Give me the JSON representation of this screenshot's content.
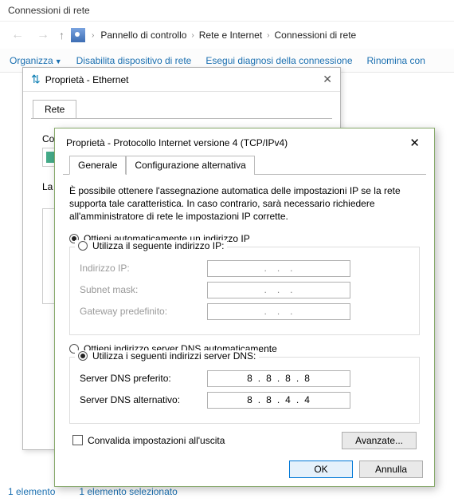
{
  "window": {
    "title": "Connessioni di rete"
  },
  "breadcrumb": {
    "items": [
      "Pannello di controllo",
      "Rete e Internet",
      "Connessioni di rete"
    ]
  },
  "toolbar": {
    "organize": "Organizza",
    "disable": "Disabilita dispositivo di rete",
    "diagnose": "Esegui diagnosi della connessione",
    "rename": "Rinomina con"
  },
  "eth_dialog": {
    "title": "Proprietà - Ethernet",
    "tab_net": "Rete",
    "connect_label": "Co",
    "list_label": "La"
  },
  "ipv4_dialog": {
    "title": "Proprietà - Protocollo Internet versione 4 (TCP/IPv4)",
    "tab_general": "Generale",
    "tab_alt": "Configurazione alternativa",
    "description": "È possibile ottenere l'assegnazione automatica delle impostazioni IP se la rete supporta tale caratteristica. In caso contrario, sarà necessario richiedere all'amministratore di rete le impostazioni IP corrette.",
    "radio_ip_auto": "Ottieni automaticamente un indirizzo IP",
    "radio_ip_manual": "Utilizza il seguente indirizzo IP:",
    "label_ip": "Indirizzo IP:",
    "label_mask": "Subnet mask:",
    "label_gateway": "Gateway predefinito:",
    "radio_dns_auto": "Ottieni indirizzo server DNS automaticamente",
    "radio_dns_manual": "Utilizza i seguenti indirizzi server DNS:",
    "label_dns1": "Server DNS preferito:",
    "label_dns2": "Server DNS alternativo:",
    "dns1": [
      "8",
      "8",
      "8",
      "8"
    ],
    "dns2": [
      "8",
      "8",
      "4",
      "4"
    ],
    "validate": "Convalida impostazioni all'uscita",
    "advanced": "Avanzate...",
    "ok": "OK",
    "cancel": "Annulla"
  },
  "status": {
    "count": "1 elemento",
    "selected": "1 elemento selezionato"
  }
}
